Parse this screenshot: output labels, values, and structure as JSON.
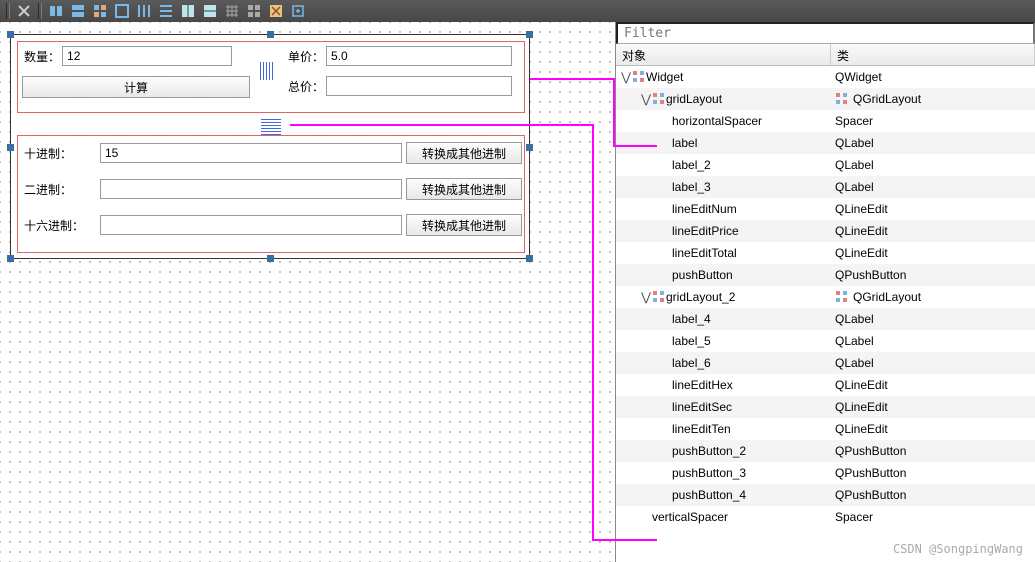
{
  "toolbar": {
    "title": ""
  },
  "filter_placeholder": "Filter",
  "form1": {
    "qty_label": "数量：",
    "qty_value": "12",
    "calc_button": "计算",
    "price_label": "单价：",
    "price_value": "5.0",
    "total_label": "总价：",
    "total_value": ""
  },
  "form2": {
    "dec_label": "十进制：",
    "dec_value": "15",
    "bin_label": "二进制：",
    "bin_value": "",
    "hex_label": "十六进制：",
    "hex_value": "",
    "convert_button": "转换成其他进制"
  },
  "tree_header": {
    "col1": "对象",
    "col2": "类"
  },
  "tree": [
    {
      "ind": 0,
      "exp": "v",
      "icon": "grid",
      "name": "Widget",
      "cls": "QWidget",
      "cicon": ""
    },
    {
      "ind": 1,
      "exp": "v",
      "icon": "grid",
      "name": "gridLayout",
      "cls": "QGridLayout",
      "cicon": "grid"
    },
    {
      "ind": 2,
      "exp": "",
      "icon": "",
      "name": "horizontalSpacer",
      "cls": "Spacer",
      "cicon": ""
    },
    {
      "ind": 2,
      "exp": "",
      "icon": "",
      "name": "label",
      "cls": "QLabel",
      "cicon": ""
    },
    {
      "ind": 2,
      "exp": "",
      "icon": "",
      "name": "label_2",
      "cls": "QLabel",
      "cicon": ""
    },
    {
      "ind": 2,
      "exp": "",
      "icon": "",
      "name": "label_3",
      "cls": "QLabel",
      "cicon": ""
    },
    {
      "ind": 2,
      "exp": "",
      "icon": "",
      "name": "lineEditNum",
      "cls": "QLineEdit",
      "cicon": ""
    },
    {
      "ind": 2,
      "exp": "",
      "icon": "",
      "name": "lineEditPrice",
      "cls": "QLineEdit",
      "cicon": ""
    },
    {
      "ind": 2,
      "exp": "",
      "icon": "",
      "name": "lineEditTotal",
      "cls": "QLineEdit",
      "cicon": ""
    },
    {
      "ind": 2,
      "exp": "",
      "icon": "",
      "name": "pushButton",
      "cls": "QPushButton",
      "cicon": ""
    },
    {
      "ind": 1,
      "exp": "v",
      "icon": "grid",
      "name": "gridLayout_2",
      "cls": "QGridLayout",
      "cicon": "grid"
    },
    {
      "ind": 2,
      "exp": "",
      "icon": "",
      "name": "label_4",
      "cls": "QLabel",
      "cicon": ""
    },
    {
      "ind": 2,
      "exp": "",
      "icon": "",
      "name": "label_5",
      "cls": "QLabel",
      "cicon": ""
    },
    {
      "ind": 2,
      "exp": "",
      "icon": "",
      "name": "label_6",
      "cls": "QLabel",
      "cicon": ""
    },
    {
      "ind": 2,
      "exp": "",
      "icon": "",
      "name": "lineEditHex",
      "cls": "QLineEdit",
      "cicon": ""
    },
    {
      "ind": 2,
      "exp": "",
      "icon": "",
      "name": "lineEditSec",
      "cls": "QLineEdit",
      "cicon": ""
    },
    {
      "ind": 2,
      "exp": "",
      "icon": "",
      "name": "lineEditTen",
      "cls": "QLineEdit",
      "cicon": ""
    },
    {
      "ind": 2,
      "exp": "",
      "icon": "",
      "name": "pushButton_2",
      "cls": "QPushButton",
      "cicon": ""
    },
    {
      "ind": 2,
      "exp": "",
      "icon": "",
      "name": "pushButton_3",
      "cls": "QPushButton",
      "cicon": ""
    },
    {
      "ind": 2,
      "exp": "",
      "icon": "",
      "name": "pushButton_4",
      "cls": "QPushButton",
      "cicon": ""
    },
    {
      "ind": 1,
      "exp": "",
      "icon": "",
      "name": "verticalSpacer",
      "cls": "Spacer",
      "cicon": ""
    }
  ],
  "watermark": "CSDN @SongpingWang"
}
